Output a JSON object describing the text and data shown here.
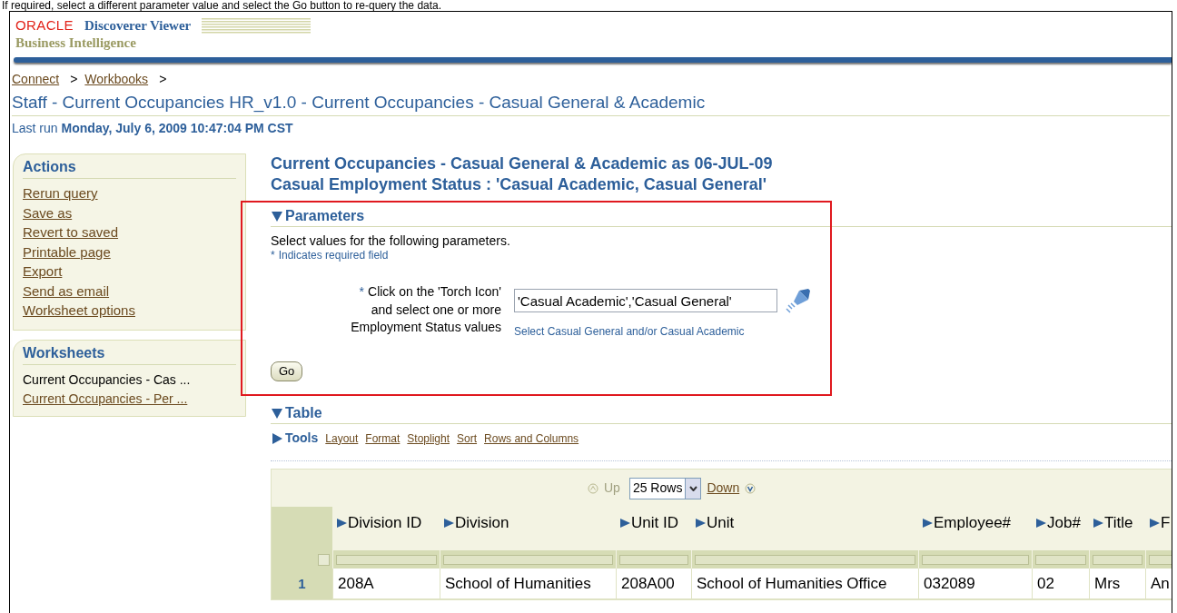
{
  "caption": "If required, select a different parameter value and select the Go button to re-query the data.",
  "header": {
    "logo": "ORACLE",
    "product": "Discoverer Viewer",
    "subtitle": "Business Intelligence"
  },
  "breadcrumbs": [
    {
      "label": "Connect",
      "separator": ">"
    },
    {
      "label": "Workbooks",
      "separator": ">"
    }
  ],
  "page_title": "Staff - Current Occupancies HR_v1.0 - Current Occupancies - Casual General & Academic",
  "last_run": {
    "label": "Last run",
    "value": "Monday, July 6, 2009 10:47:04 PM CST"
  },
  "sidebar": {
    "actions": {
      "title": "Actions",
      "items": [
        "Rerun query",
        "Save as",
        "Revert to saved",
        "Printable page",
        "Export",
        "Send as email",
        "Worksheet options"
      ]
    },
    "worksheets": {
      "title": "Worksheets",
      "items": [
        {
          "label": "Current Occupancies - Cas ...",
          "selected": true
        },
        {
          "label": "Current Occupancies - Per ...",
          "selected": false
        }
      ]
    }
  },
  "report": {
    "title_lines": [
      "Current Occupancies - Casual General & Academic as 06-JUL-09",
      "Casual Employment Status : 'Casual Academic, Casual General'"
    ],
    "parameters": {
      "title": "Parameters",
      "expanded": true,
      "intro": "Select values for the following parameters.",
      "required_mark": "*",
      "required_note": "Indicates required field",
      "field": {
        "required": true,
        "label_lines": [
          "Click on the 'Torch Icon'",
          "and select one or more",
          "Employment Status values"
        ],
        "value": "'Casual Academic','Casual General'",
        "hint": "Select Casual General and/or Casual Academic"
      },
      "go": "Go"
    },
    "table": {
      "title": "Table",
      "expanded": true,
      "tools": {
        "label": "Tools",
        "expanded": false,
        "links": [
          "Layout",
          "Format",
          "Stoplight",
          "Sort",
          "Rows and Columns"
        ]
      },
      "pager": {
        "up": "Up",
        "rows": "25 Rows",
        "down": "Down"
      },
      "select_all_checked": false,
      "columns": [
        "Division ID",
        "Division",
        "Unit ID",
        "Unit",
        "Employee#",
        "Job#",
        "Title",
        "F"
      ],
      "rows": [
        {
          "number": "1",
          "cells": [
            "208A",
            "School of Humanities",
            "208A00",
            "School of Humanities Office",
            "032089",
            "02",
            "Mrs",
            "An"
          ]
        }
      ]
    }
  }
}
